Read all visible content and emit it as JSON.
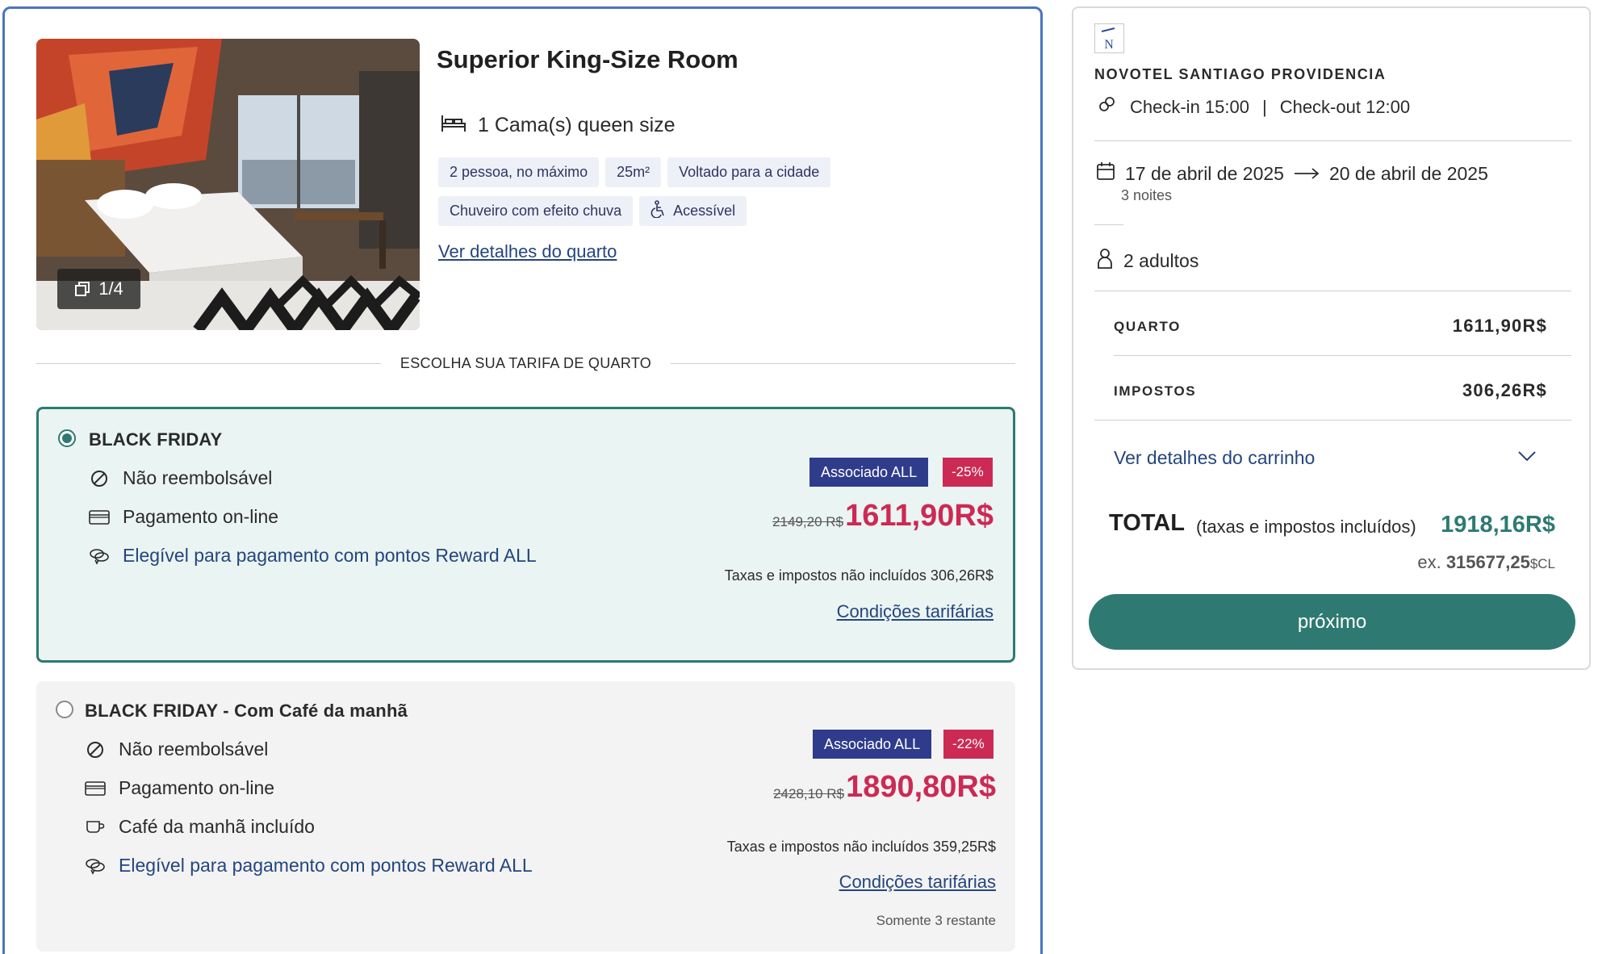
{
  "room": {
    "title": "Superior King-Size Room",
    "photo_counter": "1/4",
    "bed": "1 Cama(s) queen size",
    "chips_row_1": [
      "2 pessoa, no máximo",
      "25m²",
      "Voltado para a cidade"
    ],
    "chip_shower": "Chuveiro com efeito chuva",
    "chip_accessible": "Acessível",
    "details_link": "Ver detalhes do quarto",
    "rate_heading": "ESCOLHA SUA TARIFA DE QUARTO"
  },
  "rates": [
    {
      "name": "BLACK FRIDAY",
      "selected": true,
      "features": {
        "refund": "Não reembolsável",
        "payment": "Pagamento on-line",
        "reward": "Elegível para pagamento com pontos Reward ALL"
      },
      "member_badge": "Associado ALL",
      "discount_badge": "-25%",
      "old_price": "2149,20 R$",
      "price": "1611,90R$",
      "tax_note": "Taxas e impostos não incluídos 306,26R$",
      "conditions_link": "Condições tarifárias"
    },
    {
      "name": "BLACK FRIDAY - Com Café da manhã",
      "selected": false,
      "features": {
        "refund": "Não reembolsável",
        "payment": "Pagamento on-line",
        "breakfast": "Café da manhã incluído",
        "reward": "Elegível para pagamento com pontos Reward ALL"
      },
      "member_badge": "Associado ALL",
      "discount_badge": "-22%",
      "old_price": "2428,10 R$",
      "price": "1890,80R$",
      "tax_note": "Taxas e impostos não incluídos 359,25R$",
      "conditions_link": "Condições tarifárias",
      "remaining": "Somente 3 restante"
    }
  ],
  "summary": {
    "hotel_logo_letter": "N",
    "hotel_name": "NOVOTEL SANTIAGO PROVIDENCIA",
    "checkin": "Check-in 15:00",
    "separator": "|",
    "checkout": "Check-out 12:00",
    "date_from": "17 de abril de 2025",
    "date_to": "20 de abril de 2025",
    "nights": "3 noites",
    "guests": "2 adultos",
    "room_label": "QUARTO",
    "room_value": "1611,90R$",
    "taxes_label": "IMPOSTOS",
    "taxes_value": "306,26R$",
    "cart_link": "Ver detalhes do carrinho",
    "total_label": "TOTAL",
    "total_note": "(taxas e impostos incluídos)",
    "total_value": "1918,16R$",
    "points_prefix": "ex.",
    "points_value": "315677,25",
    "points_currency": "$CL",
    "next_button": "próximo"
  },
  "colors": {
    "accent_teal": "#2e7a72",
    "price_red": "#cc2a54",
    "member_navy": "#2f3c8c",
    "link_blue": "#24457e",
    "card_border_blue": "#4a74c0"
  }
}
